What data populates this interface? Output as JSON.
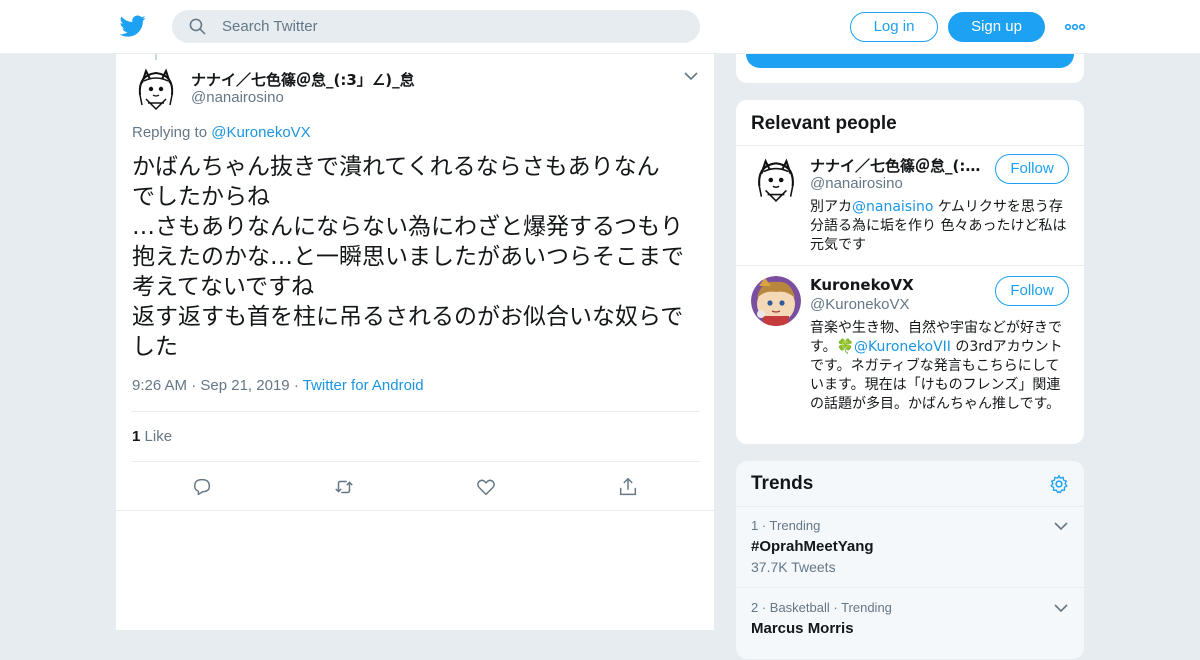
{
  "colors": {
    "brand": "#1da1f2",
    "link": "#1b95e0",
    "secondary_text": "#657786",
    "background": "#e6ecf0"
  },
  "header": {
    "logo_icon": "twitter-bird-icon",
    "search": {
      "placeholder": "Search Twitter"
    },
    "login_label": "Log in",
    "signup_label": "Sign up",
    "more_icon": "ellipsis-icon"
  },
  "tweet": {
    "author_name": "ナナイ／七色篠＠怠_(:3」∠)_怠",
    "author_handle": "@nanairosino",
    "replying_prefix": "Replying to",
    "replying_to": "@KuronekoVX",
    "text": "かばんちゃん抜きで潰れてくれるならさもありなん\nでしたからね\n…さもありなんにならない為にわざと爆発するつもり\n抱えたのかな…と一瞬思いましたがあいつらそこまで\n考えてないですね\n返す返すも首を柱に吊るされるのがお似合いな奴らで\nした",
    "time": "9:26 AM",
    "date": "Sep 21, 2019",
    "source": "Twitter for Android",
    "like_count": "1",
    "like_label": "Like",
    "actions": [
      "reply-icon",
      "retweet-icon",
      "like-icon",
      "share-icon"
    ]
  },
  "relevant_people": {
    "title": "Relevant people",
    "people": [
      {
        "name": "ナナイ／七色篠＠怠_(:3」∠)_怠",
        "handle": "@nanairosino",
        "follow_label": "Follow",
        "bio_prefix": "別アカ",
        "bio_link": "@nanaisino",
        "bio_rest": " ケムリクサを思う存分語る為に垢を作り 色々あったけど私は元気です"
      },
      {
        "name": "KuronekoVX",
        "handle": "@KuronekoVX",
        "follow_label": "Follow",
        "bio_prefix": "音楽や生き物、自然や宇宙などが好きです。",
        "bio_emoji": "🍀",
        "bio_link": "@KuronekoVII",
        "bio_rest": " の3rdアカウントです。ネガティブな発言もこちらにしています。現在は「けものフレンズ」関連の話題が多目。かばんちゃん推しです。"
      }
    ]
  },
  "trends": {
    "title": "Trends",
    "settings_icon": "gear-icon",
    "items": [
      {
        "context": "1 · Trending",
        "name": "#OprahMeetYang",
        "count": "37.7K Tweets"
      },
      {
        "context": "2 · Basketball · Trending",
        "name": "Marcus Morris"
      }
    ]
  }
}
